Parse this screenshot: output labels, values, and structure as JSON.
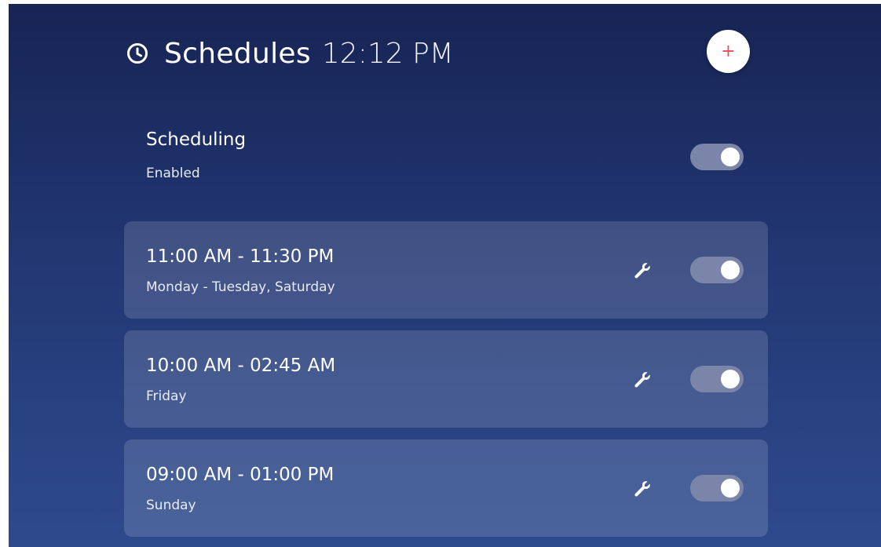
{
  "header": {
    "title": "Schedules",
    "time": "12:12 PM",
    "add_label": "+"
  },
  "scheduling": {
    "title": "Scheduling",
    "status": "Enabled",
    "enabled": true
  },
  "schedules": [
    {
      "time_range": "11:00 AM - 11:30 PM",
      "days": "Monday - Tuesday, Saturday",
      "enabled": true
    },
    {
      "time_range": "10:00 AM - 02:45 AM",
      "days": "Friday",
      "enabled": true
    },
    {
      "time_range": "09:00 AM - 01:00 PM",
      "days": "Sunday",
      "enabled": true
    }
  ],
  "icons": {
    "header": "clock-icon",
    "edit": "wrench-icon",
    "add": "plus-icon"
  },
  "colors": {
    "background_top": "#172454",
    "background_bottom": "#2e4b8d",
    "add_plus": "#e2505a",
    "toggle_track": "#7a85a9"
  }
}
